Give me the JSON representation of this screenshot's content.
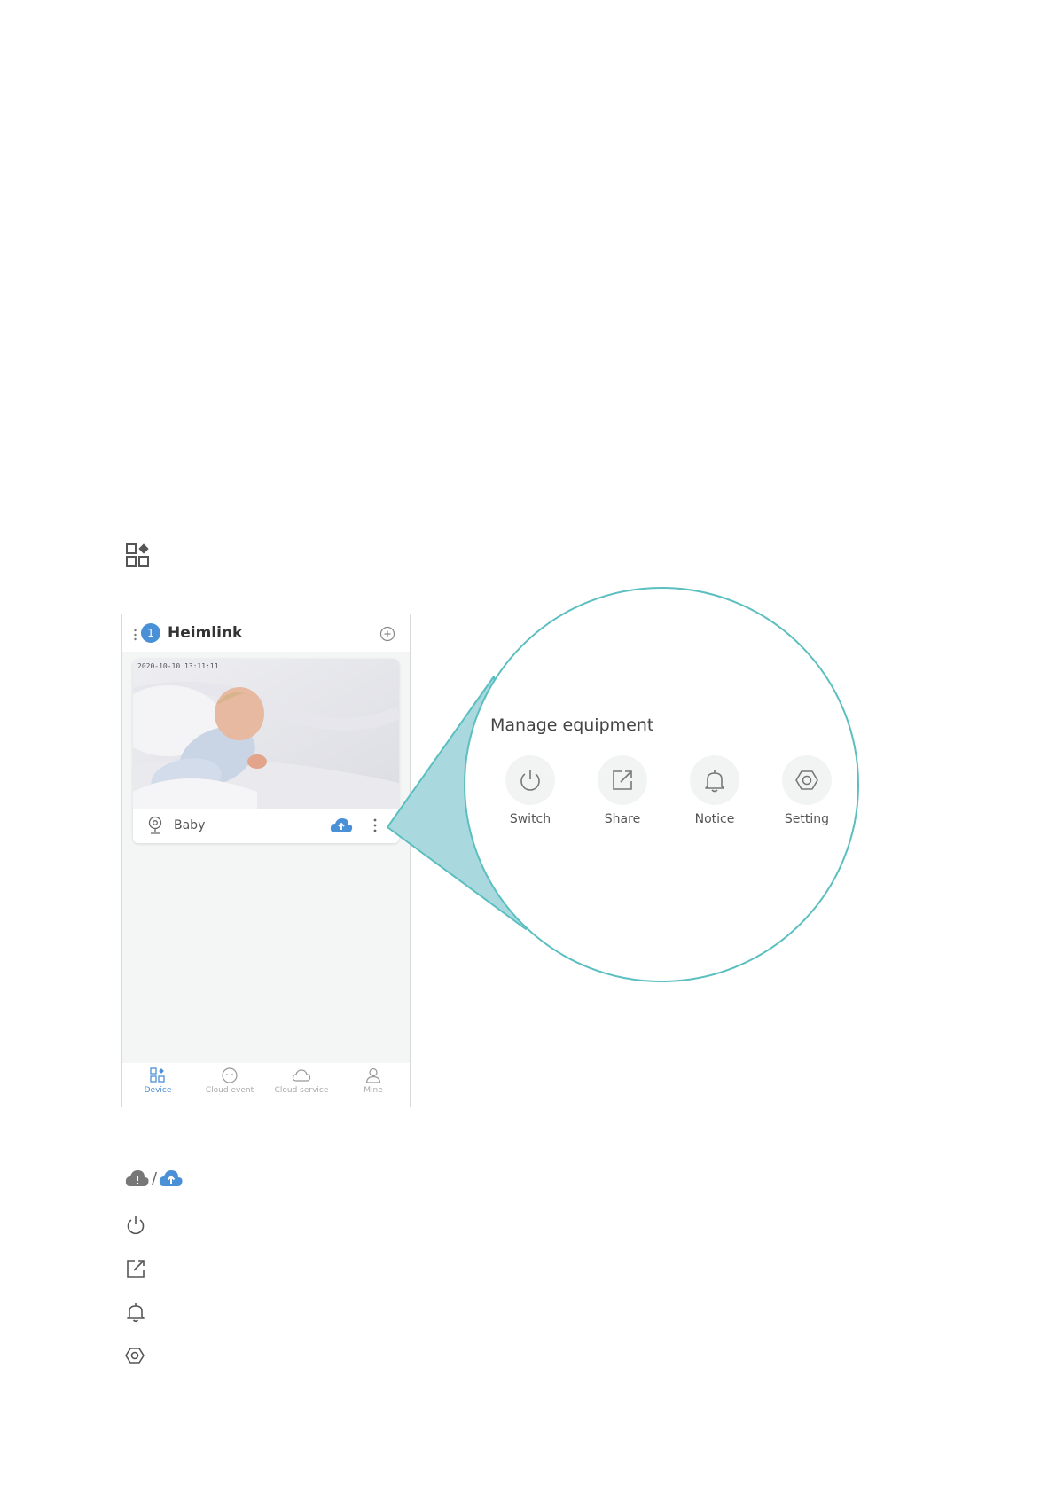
{
  "colors": {
    "accent": "#4a90d6",
    "callout_teal": "#5bbfc0",
    "callout_fill": "#a9d9de"
  },
  "app": {
    "title": "Heimlink",
    "device_count": "1"
  },
  "camera": {
    "timestamp": "2020-10-10  13:11:11",
    "name": "Baby"
  },
  "bottom_nav": [
    {
      "label": "Device",
      "icon": "device-grid-icon",
      "active": true
    },
    {
      "label": "Cloud event",
      "icon": "cloud-event-icon",
      "active": false
    },
    {
      "label": "Cloud service",
      "icon": "cloud-icon",
      "active": false
    },
    {
      "label": "Mine",
      "icon": "user-icon",
      "active": false
    }
  ],
  "manage_menu": {
    "title": "Manage equipment",
    "items": [
      {
        "label": "Switch",
        "icon": "power-icon"
      },
      {
        "label": "Share",
        "icon": "share-icon"
      },
      {
        "label": "Notice",
        "icon": "bell-icon"
      },
      {
        "label": "Setting",
        "icon": "gear-icon"
      }
    ]
  },
  "legend": {
    "cloud_separator": "/"
  }
}
